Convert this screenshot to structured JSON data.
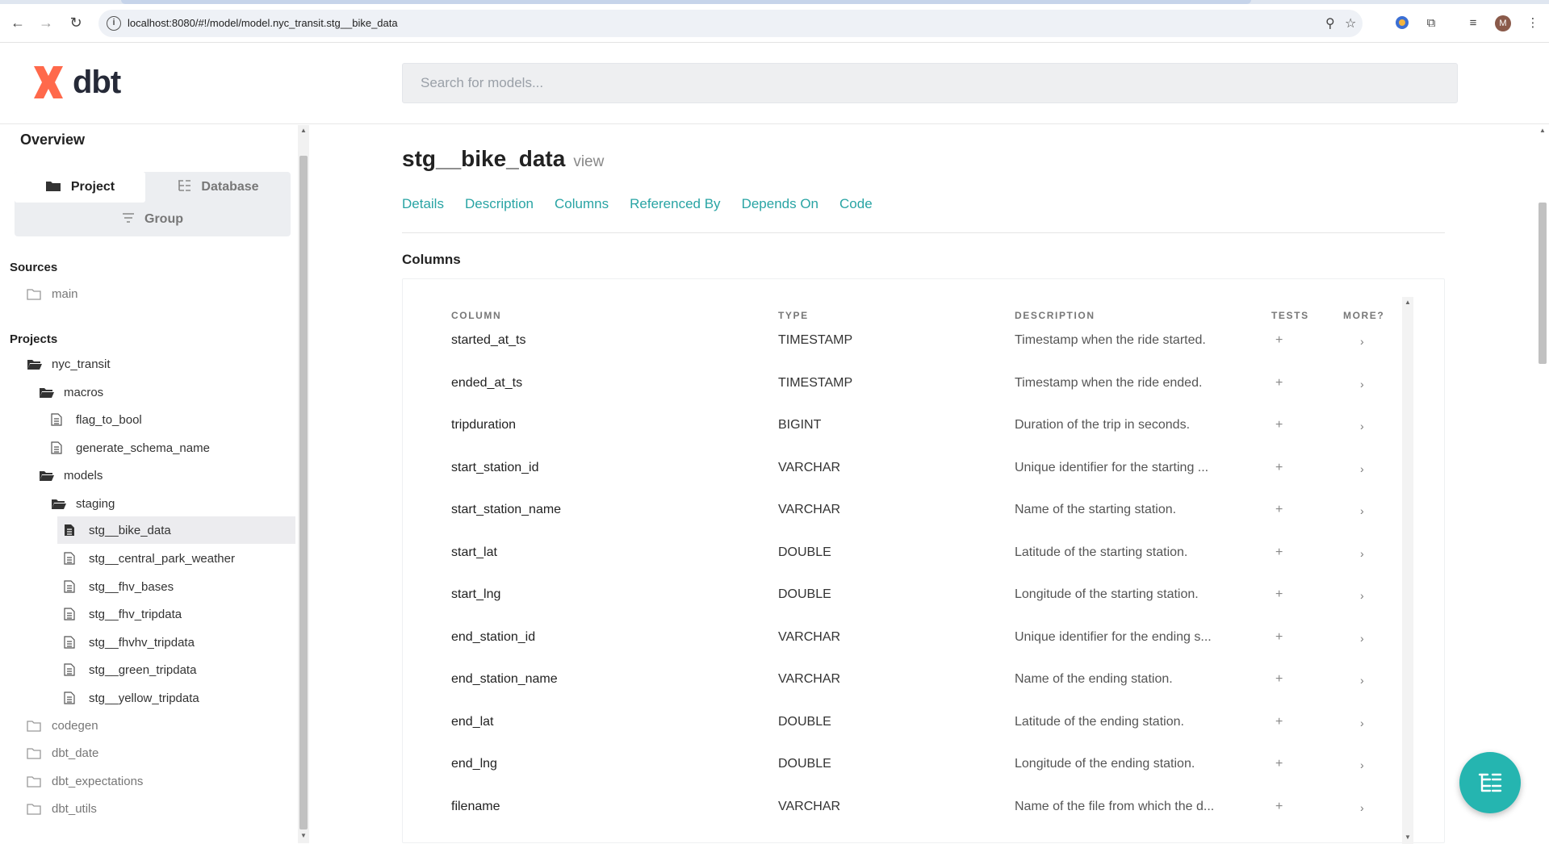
{
  "browser": {
    "url": "localhost:8080/#!/model/model.nyc_transit.stg__bike_data",
    "profile_initial": "M"
  },
  "header": {
    "logo_text": "dbt",
    "search_placeholder": "Search for models..."
  },
  "sidebar": {
    "overview_label": "Overview",
    "switcher": {
      "project": "Project",
      "database": "Database",
      "group": "Group"
    },
    "sources_title": "Sources",
    "sources": [
      "main"
    ],
    "projects_title": "Projects",
    "tree": {
      "nyc_transit": "nyc_transit",
      "macros": "macros",
      "macro_items": [
        "flag_to_bool",
        "generate_schema_name"
      ],
      "models": "models",
      "staging": "staging",
      "staging_items": [
        "stg__bike_data",
        "stg__central_park_weather",
        "stg__fhv_bases",
        "stg__fhv_tripdata",
        "stg__fhvhv_tripdata",
        "stg__green_tripdata",
        "stg__yellow_tripdata"
      ],
      "packages": [
        "codegen",
        "dbt_date",
        "dbt_expectations",
        "dbt_utils"
      ]
    }
  },
  "main": {
    "model_name": "stg__bike_data",
    "model_kind": "view",
    "tabs": [
      "Details",
      "Description",
      "Columns",
      "Referenced By",
      "Depends On",
      "Code"
    ],
    "section_label": "Columns",
    "table": {
      "headers": {
        "column": "COLUMN",
        "type": "TYPE",
        "description": "DESCRIPTION",
        "tests": "TESTS",
        "more": "MORE?"
      },
      "rows": [
        {
          "column": "started_at_ts",
          "type": "TIMESTAMP",
          "description": "Timestamp when the ride started."
        },
        {
          "column": "ended_at_ts",
          "type": "TIMESTAMP",
          "description": "Timestamp when the ride ended."
        },
        {
          "column": "tripduration",
          "type": "BIGINT",
          "description": "Duration of the trip in seconds."
        },
        {
          "column": "start_station_id",
          "type": "VARCHAR",
          "description": "Unique identifier for the starting ..."
        },
        {
          "column": "start_station_name",
          "type": "VARCHAR",
          "description": "Name of the starting station."
        },
        {
          "column": "start_lat",
          "type": "DOUBLE",
          "description": "Latitude of the starting station."
        },
        {
          "column": "start_lng",
          "type": "DOUBLE",
          "description": "Longitude of the starting station."
        },
        {
          "column": "end_station_id",
          "type": "VARCHAR",
          "description": "Unique identifier for the ending s..."
        },
        {
          "column": "end_station_name",
          "type": "VARCHAR",
          "description": "Name of the ending station."
        },
        {
          "column": "end_lat",
          "type": "DOUBLE",
          "description": "Latitude of the ending station."
        },
        {
          "column": "end_lng",
          "type": "DOUBLE",
          "description": "Longitude of the ending station."
        },
        {
          "column": "filename",
          "type": "VARCHAR",
          "description": "Name of the file from which the d..."
        }
      ],
      "tests_symbol": "+",
      "more_symbol": "›"
    }
  },
  "colors": {
    "accent": "#29a4a4",
    "fab": "#25b5b0",
    "logo": "#ff694b"
  }
}
